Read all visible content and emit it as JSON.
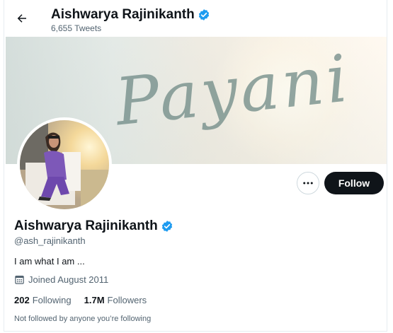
{
  "header": {
    "name": "Aishwarya Rajinikanth",
    "tweet_count": "6,655 Tweets"
  },
  "banner": {
    "text": "Payani"
  },
  "actions": {
    "follow_label": "Follow"
  },
  "profile": {
    "name": "Aishwarya Rajinikanth",
    "handle": "@ash_rajinikanth",
    "bio": "I am what I am ...",
    "joined": "Joined August 2011",
    "following_count": "202",
    "following_label": "Following",
    "followers_count": "1.7M",
    "followers_label": "Followers",
    "followed_by_note": "Not followed by anyone you’re following"
  },
  "icons": {
    "back": "arrow-left-icon",
    "verified": "verified-badge-icon",
    "more": "more-horizontal-icon",
    "calendar": "calendar-icon"
  },
  "colors": {
    "verified": "#1d9bf0",
    "follow_button": "#0f1419",
    "secondary_text": "#536471"
  }
}
